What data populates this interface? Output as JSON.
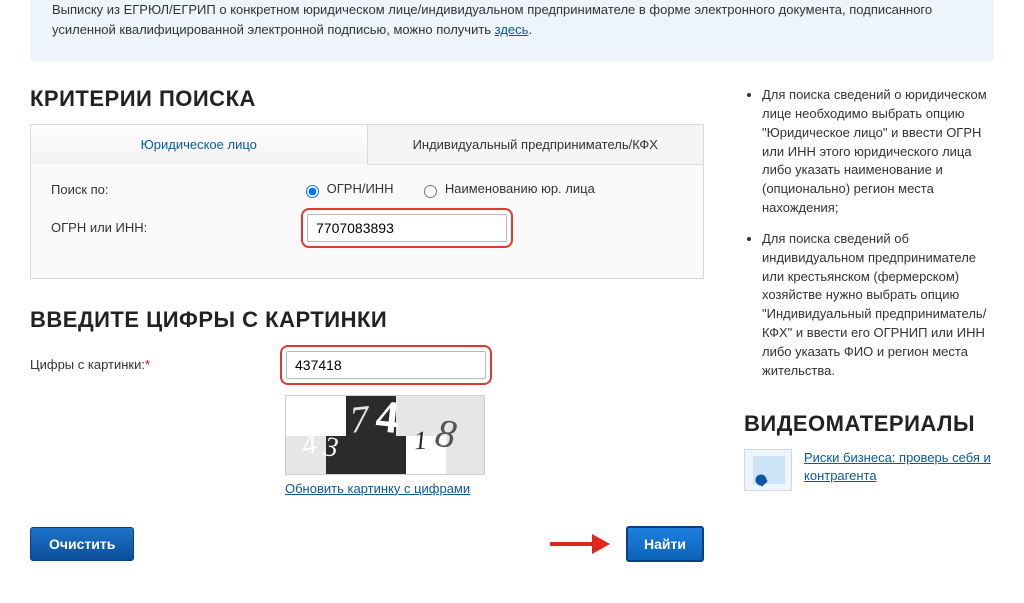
{
  "notice": {
    "text_before": "Выписку из ЕГРЮЛ/ЕГРИП о конкретном юридическом лице/индивидуальном предпринимателе в форме электронного документа, подписанного усиленной квалифицированной электронной подписью, можно получить ",
    "link_text": "здесь",
    "text_after": "."
  },
  "headings": {
    "criteria": "КРИТЕРИИ ПОИСКА",
    "captcha": "ВВЕДИТЕ ЦИФРЫ С КАРТИНКИ",
    "video": "ВИДЕОМАТЕРИАЛЫ"
  },
  "tabs": {
    "legal": "Юридическое лицо",
    "individual": "Индивидуальный предприниматель/КФХ"
  },
  "labels": {
    "search_by": "Поиск по:",
    "ogrn_inn": "ОГРН или ИНН:",
    "captcha_field": "Цифры с картинки:"
  },
  "radios": {
    "ogrn_inn": "ОГРН/ИНН",
    "by_name": "Наименованию юр. лица"
  },
  "inputs": {
    "ogrn_value": "7707083893",
    "captcha_value": "437418"
  },
  "captcha": {
    "digits": [
      "4",
      "3",
      "7",
      "4",
      "1",
      "8"
    ],
    "refresh": "Обновить картинку с цифрами"
  },
  "buttons": {
    "clear": "Очистить",
    "find": "Найти"
  },
  "help": {
    "item1": "Для поиска сведений о юридическом лице необходимо выбрать опцию \"Юридическое лицо\" и ввести ОГРН или ИНН этого юридического лица либо указать наименование и (опционально) регион места нахождения;",
    "item2": "Для поиска сведений об индивидуальном предпринимателе или крестьянском (фермерском) хозяйстве нужно выбрать опцию \"Индивидуальный предприниматель/КФХ\" и ввести его ОГРНИП или ИНН либо указать ФИО и регион места жительства."
  },
  "video": {
    "link": "Риски бизнеса: проверь себя и контрагента"
  }
}
